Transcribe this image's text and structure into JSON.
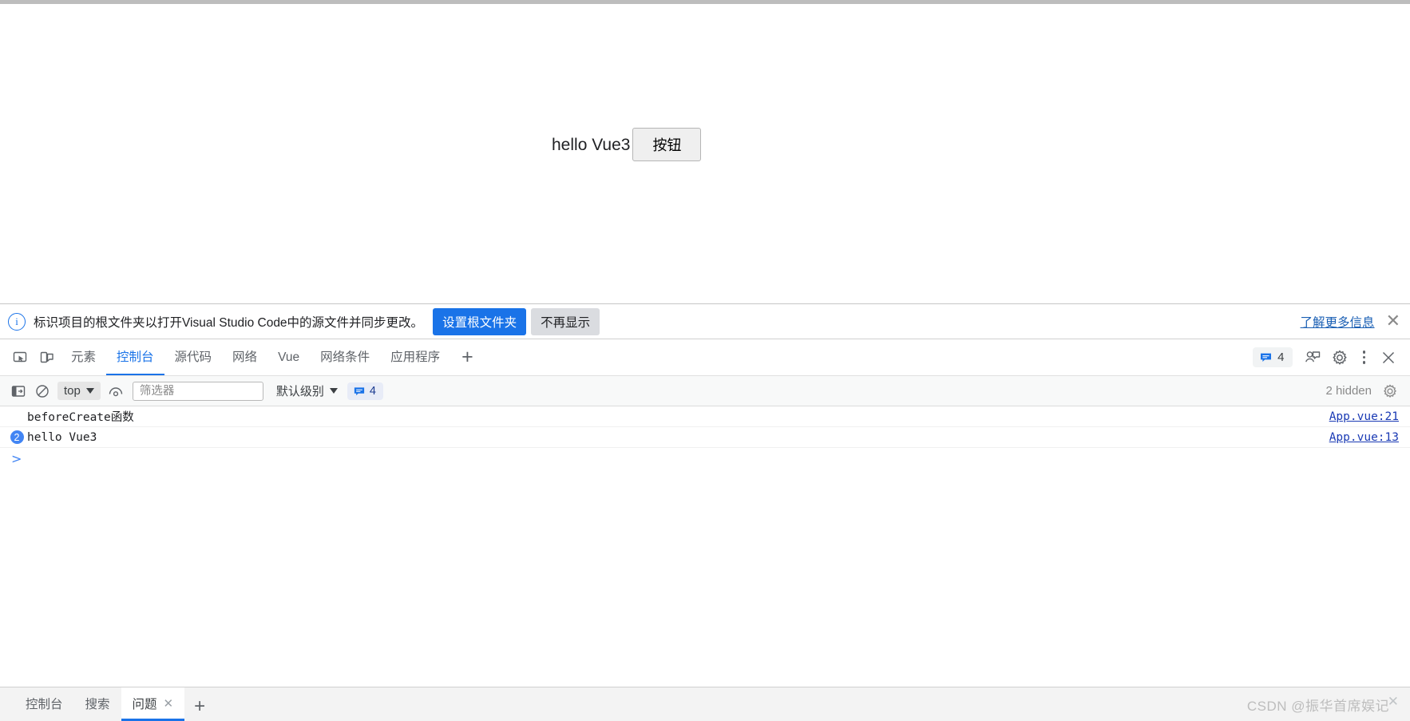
{
  "page": {
    "text": "hello Vue3",
    "button_label": "按钮"
  },
  "infobar": {
    "icon": "info-circle-icon",
    "message": "标识项目的根文件夹以打开Visual Studio Code中的源文件并同步更改。",
    "primary_button": "设置根文件夹",
    "secondary_button": "不再显示",
    "link": "了解更多信息",
    "close": "✕",
    "primary_color": "#1a73e8"
  },
  "devtools": {
    "tabs": [
      {
        "label": "元素",
        "active": false
      },
      {
        "label": "控制台",
        "active": true
      },
      {
        "label": "源代码",
        "active": false
      },
      {
        "label": "网络",
        "active": false
      },
      {
        "label": "Vue",
        "active": false
      },
      {
        "label": "网络条件",
        "active": false
      },
      {
        "label": "应用程序",
        "active": false
      }
    ],
    "add_tab": "+",
    "message_count": "4",
    "accent_color": "#1a73e8",
    "close": "✕"
  },
  "console_toolbar": {
    "context": "top",
    "filter_placeholder": "筛选器",
    "filter_value": "",
    "level": "默认级别",
    "level_count": "4",
    "hidden_text": "2 hidden"
  },
  "console_logs": [
    {
      "count": "",
      "message": "beforeCreate函数",
      "source": "App.vue:21"
    },
    {
      "count": "2",
      "message": "hello Vue3",
      "source": "App.vue:13"
    }
  ],
  "console_prompt": ">",
  "drawer": {
    "tabs": [
      {
        "label": "控制台",
        "active": false,
        "closable": false
      },
      {
        "label": "搜索",
        "active": false,
        "closable": false
      },
      {
        "label": "问题",
        "active": true,
        "closable": true
      }
    ],
    "close_glyph": "✕",
    "add_tab": "+",
    "watermark": "CSDN @振华首席娱记",
    "close": "✕"
  }
}
